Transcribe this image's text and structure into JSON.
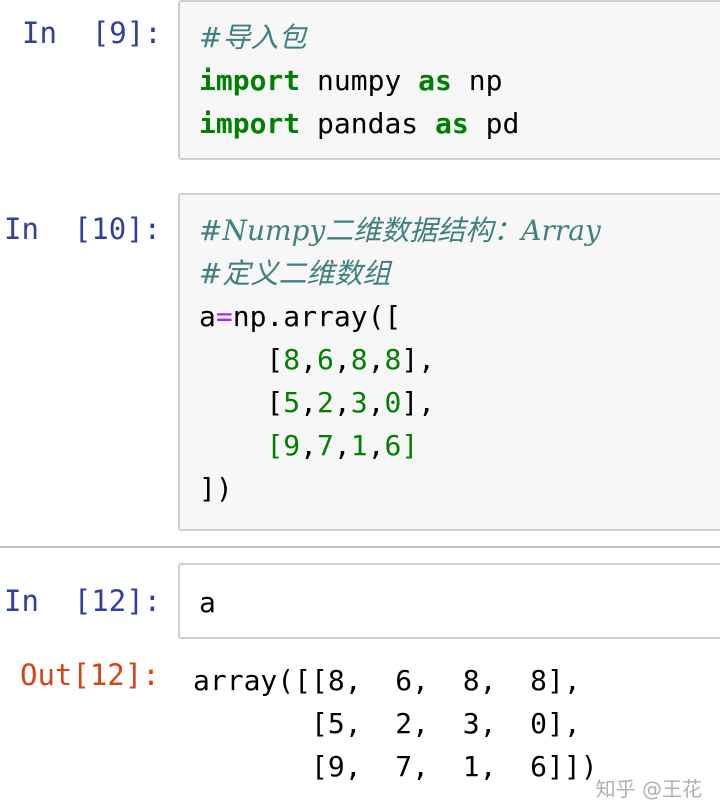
{
  "cells": [
    {
      "prompt": "In  [9]:",
      "lines": [
        {
          "comment": "#导入包"
        },
        {
          "kw1": "import",
          "t1": " numpy ",
          "kw2": "as",
          "t2": " np"
        },
        {
          "kw1": "import",
          "t1": " pandas ",
          "kw2": "as",
          "t2": " pd"
        }
      ]
    },
    {
      "prompt": "In  [10]:",
      "lines": [
        {
          "comment": "#Numpy二维数据结构：Array"
        },
        {
          "comment": "#定义二维数组"
        },
        {
          "a": "a",
          "op": "=",
          "rest": "np.array(["
        },
        {
          "row": [
            "8",
            "6",
            "8",
            "8"
          ],
          "end": "],"
        },
        {
          "row": [
            "5",
            "2",
            "3",
            "0"
          ],
          "end": "],"
        },
        {
          "row": [
            "9",
            "7",
            "1",
            "6"
          ],
          "end": "]"
        },
        {
          "close": "])"
        }
      ]
    },
    {
      "prompt": "In  [12]:",
      "lines": [
        {
          "text": "a"
        }
      ]
    }
  ],
  "output": {
    "prompt": "Out[12]:",
    "lines": [
      "array([[8,  6,  8,  8],",
      "       [5,  2,  3,  0],",
      "       [9,  7,  1,  6]])"
    ]
  },
  "watermark": "知乎 @王花"
}
